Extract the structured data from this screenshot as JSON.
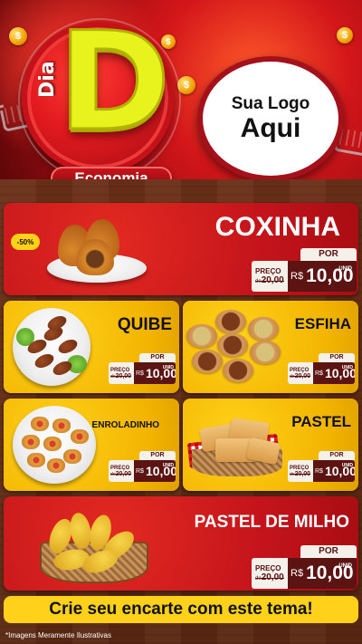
{
  "header": {
    "logo_dia": "Dia",
    "logo_d": "D",
    "logo_economia": "Economia",
    "logo_placeholder_line1": "Sua Logo",
    "logo_placeholder_line2": "Aqui",
    "coin_symbol": "$"
  },
  "price_common": {
    "por": "POR",
    "preco": "PREÇO",
    "de": "de",
    "old_value": "20,00",
    "currency": "R$",
    "new_value": "10,00",
    "unid": "UNID"
  },
  "products": [
    {
      "name": "COXINHA",
      "badge": "-50%"
    },
    {
      "name": "QUIBE"
    },
    {
      "name": "ESFIHA"
    },
    {
      "name": "ENROLADINHO"
    },
    {
      "name": "PASTEL"
    },
    {
      "name": "PASTEL DE MILHO"
    }
  ],
  "footer": {
    "cta": "Crie seu encarte com este tema!",
    "note": "*Imagens Meramente Ilustrativas"
  },
  "colors": {
    "red": "#c4141b",
    "yellow": "#f2b400",
    "wood": "#5a2812",
    "price_dark": "#5c1412"
  }
}
